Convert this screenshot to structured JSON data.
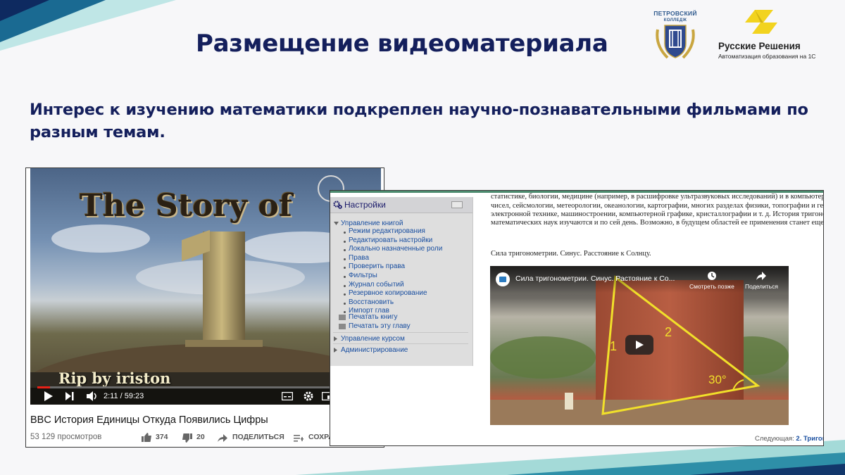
{
  "header": {
    "title": "Размещение видеоматериала",
    "subtitle": "Интерес к изучению математики подкреплен научно-познавательными фильмами по разным темам."
  },
  "logos": {
    "college": {
      "line1": "ПЕТРОВСКИЙ",
      "line2": "КОЛЛЕДЖ"
    },
    "brand": {
      "name": "Русские Решения",
      "tagline": "Автоматизация образования на 1С"
    }
  },
  "left_video": {
    "overlay_title": "The Story of",
    "overlay_number": "1",
    "watermark": "Rip by iriston",
    "time": "2:11 / 59:23",
    "progress": 0.037,
    "title": "BBC История Единицы Откуда Появились Цифры",
    "views": "53 129 просмотров",
    "likes": "374",
    "dislikes": "20",
    "share_label": "ПОДЕЛИТЬСЯ",
    "save_label": "СОХРА"
  },
  "moodle": {
    "settings": {
      "title": "Настройки",
      "book_admin": "Управление книгой",
      "items": [
        "Режим редактирования",
        "Редактировать настройки",
        "Локально назначенные роли",
        "Права",
        "Проверить права",
        "Фильтры",
        "Журнал событий",
        "Резервное копирование",
        "Восстановить",
        "Импорт глав"
      ],
      "print_items": [
        "Печатать книгу",
        "Печатать эту главу"
      ],
      "course_admin": "Управление курсом",
      "site_admin": "Администрирование"
    },
    "text_lines": [
      "статистике, биологии, медицине (например, в расшифровке ультразвуковых исследований) и в компьютерной то",
      "чисел, сейсмологии, метеорологии, океанологии, картографии, многих разделах физики, топографии и геодезии,",
      "электронной технике, машиностроении, компьютерной графике, кристаллографии и т. д. История тригонометрии",
      "математических наук изучаются и по сей день. Возможно, в будущем областей ее применения станет еще больше."
    ],
    "caption": "Сила тригонометрии. Синус. Расстояние к Солнцу.",
    "embed": {
      "title": "Сила тригонометрии. Синус. Растояние к Со...",
      "watch_later": "Смотреть позже",
      "share": "Поделиться",
      "label_1": "1",
      "label_2": "2",
      "angle": "30°"
    },
    "next_prefix": "Следующая:",
    "next_link": "2. Тригон"
  }
}
